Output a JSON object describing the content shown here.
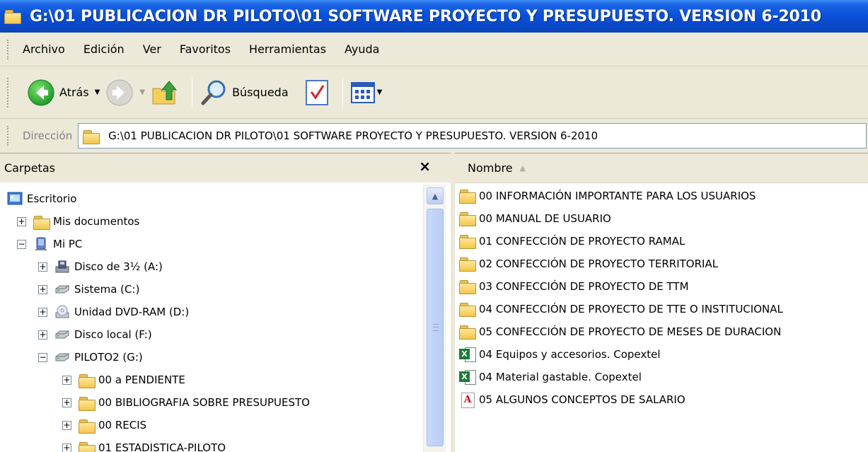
{
  "window": {
    "title": "G:\\01 PUBLICACION DR PILOTO\\01 SOFTWARE PROYECTO Y  PRESUPUESTO. VERSION 6-2010"
  },
  "menu": {
    "items": [
      "Archivo",
      "Edición",
      "Ver",
      "Favoritos",
      "Herramientas",
      "Ayuda"
    ]
  },
  "toolbar": {
    "back_label": "Atrás",
    "search_label": "Búsqueda"
  },
  "address": {
    "label": "Dirección",
    "path": "G:\\01 PUBLICACION DR PILOTO\\01 SOFTWARE PROYECTO Y  PRESUPUESTO. VERSION 6-2010"
  },
  "folders_pane": {
    "title": "Carpetas",
    "close_glyph": "×",
    "tree": [
      {
        "label": "Escritorio",
        "icon": "desktop-icon",
        "expander": ""
      },
      {
        "label": "Mis documentos",
        "icon": "my-documents-icon",
        "expander": "+"
      },
      {
        "label": "Mi PC",
        "icon": "my-computer-icon",
        "expander": "−"
      },
      {
        "label": "Disco de 3½ (A:)",
        "icon": "floppy-drive-icon",
        "expander": "+"
      },
      {
        "label": "Sistema (C:)",
        "icon": "hard-drive-icon",
        "expander": "+"
      },
      {
        "label": "Unidad DVD-RAM (D:)",
        "icon": "dvd-drive-icon",
        "expander": "+"
      },
      {
        "label": "Disco local (F:)",
        "icon": "hard-drive-icon",
        "expander": "+"
      },
      {
        "label": "PILOTO2 (G:)",
        "icon": "hard-drive-icon",
        "expander": "−"
      },
      {
        "label": "00 a PENDIENTE",
        "icon": "folder-icon",
        "expander": "+"
      },
      {
        "label": "00 BIBLIOGRAFIA SOBRE PRESUPUESTO",
        "icon": "folder-icon",
        "expander": "+"
      },
      {
        "label": "00 RECIS",
        "icon": "folder-icon",
        "expander": "+"
      },
      {
        "label": "01 ESTADISTICA-PILOTO",
        "icon": "folder-icon",
        "expander": "+"
      }
    ]
  },
  "files_pane": {
    "column_name": "Nombre",
    "items": [
      {
        "name": "00 INFORMACIÓN IMPORTANTE PARA LOS USUARIOS",
        "icon": "folder-icon"
      },
      {
        "name": "00 MANUAL DE USUARIO",
        "icon": "folder-icon"
      },
      {
        "name": "01 CONFECCIÓN DE PROYECTO RAMAL",
        "icon": "folder-icon"
      },
      {
        "name": "02 CONFECCIÓN DE PROYECTO TERRITORIAL",
        "icon": "folder-icon"
      },
      {
        "name": "03 CONFECCIÓN DE PROYECTO DE TTM",
        "icon": "folder-icon"
      },
      {
        "name": "04 CONFECCIÓN DE PROYECTO DE TTE O INSTITUCIONAL",
        "icon": "folder-icon"
      },
      {
        "name": "05 CONFECCIÓN DE PROYECTO DE MESES DE DURACION",
        "icon": "folder-icon"
      },
      {
        "name": "04 Equipos y accesorios. Copextel",
        "icon": "excel-file-icon"
      },
      {
        "name": "04 Material gastable. Copextel",
        "icon": "excel-file-icon"
      },
      {
        "name": "05 ALGUNOS CONCEPTOS DE SALARIO",
        "icon": "pdf-file-icon"
      }
    ]
  },
  "colors": {
    "title_bar": "#0a52d9",
    "chrome": "#ece9d8",
    "scroll_thumb": "#c1d3fb"
  }
}
